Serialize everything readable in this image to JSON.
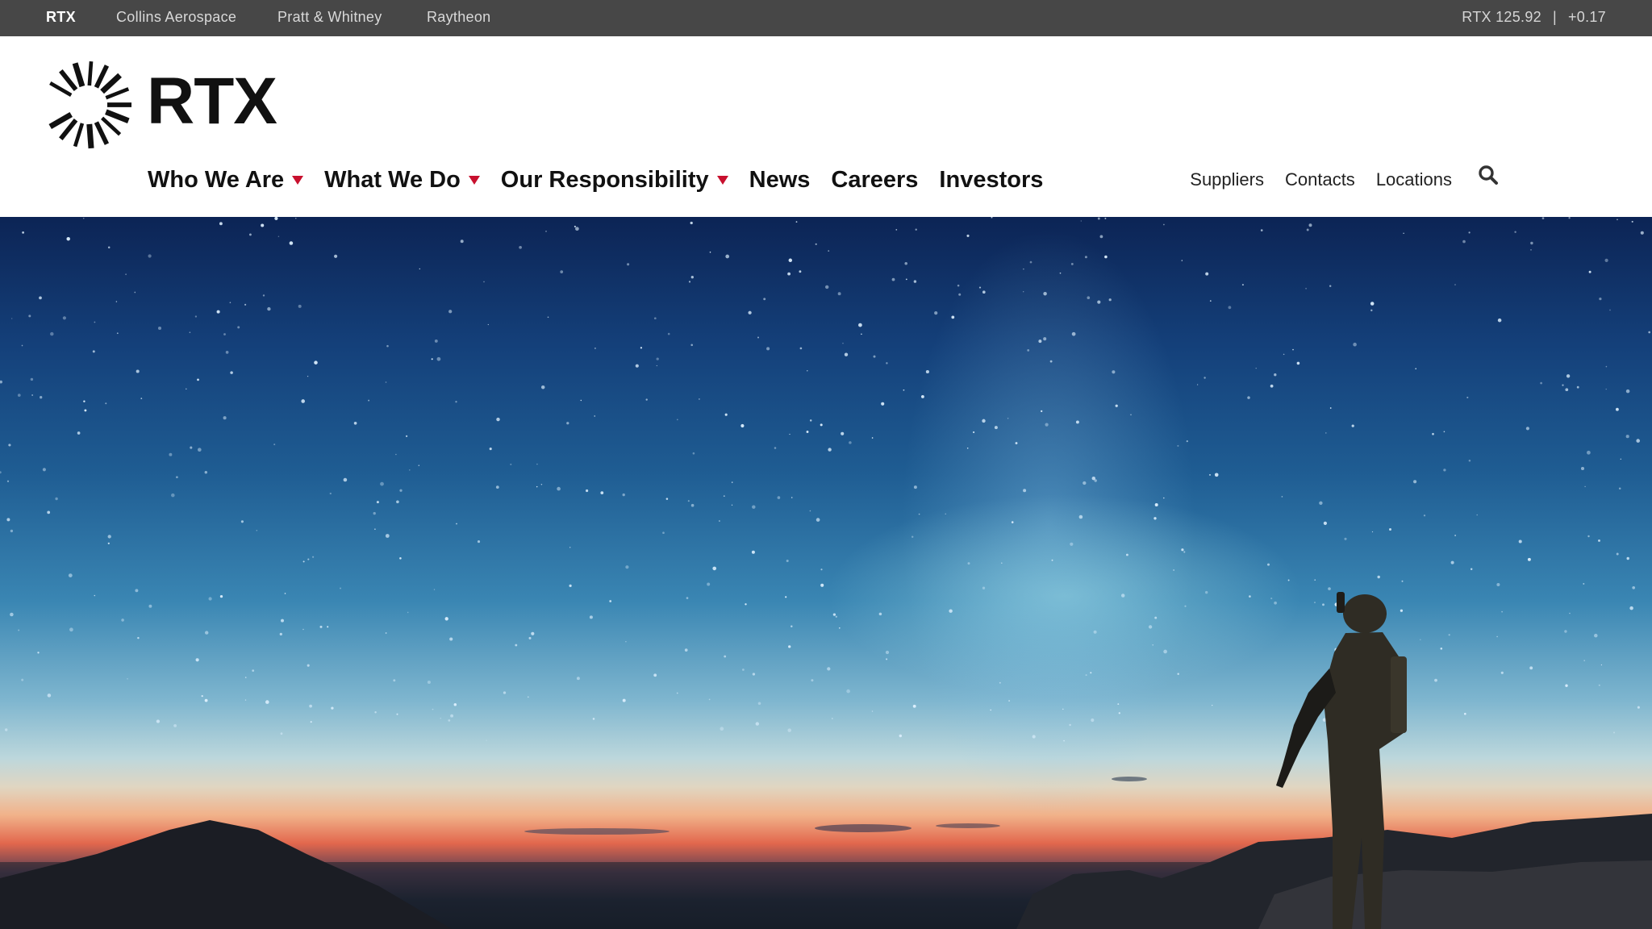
{
  "utility_bar": {
    "brands": [
      {
        "label": "RTX",
        "active": true
      },
      {
        "label": "Collins Aerospace",
        "active": false
      },
      {
        "label": "Pratt & Whitney",
        "active": false
      },
      {
        "label": "Raytheon",
        "active": false
      }
    ],
    "stock": {
      "ticker_price": "RTX 125.92",
      "separator": "|",
      "change": "+0.17"
    }
  },
  "header": {
    "logo": {
      "wordmark": "RTX",
      "icon": "rtx-sunburst-logo"
    },
    "main_nav": [
      {
        "label": "Who We Are",
        "has_dropdown": true
      },
      {
        "label": "What We Do",
        "has_dropdown": true
      },
      {
        "label": "Our Responsibility",
        "has_dropdown": true
      },
      {
        "label": "News",
        "has_dropdown": false
      },
      {
        "label": "Careers",
        "has_dropdown": false
      },
      {
        "label": "Investors",
        "has_dropdown": false
      }
    ],
    "secondary_nav": [
      {
        "label": "Suppliers"
      },
      {
        "label": "Contacts"
      },
      {
        "label": "Locations"
      }
    ],
    "search_icon": "search-icon"
  },
  "colors": {
    "utility_bg": "#474747",
    "accent_red": "#c8102e",
    "text_dark": "#111111"
  },
  "hero": {
    "image": "night-sky-milky-way-soldier-silhouette"
  }
}
